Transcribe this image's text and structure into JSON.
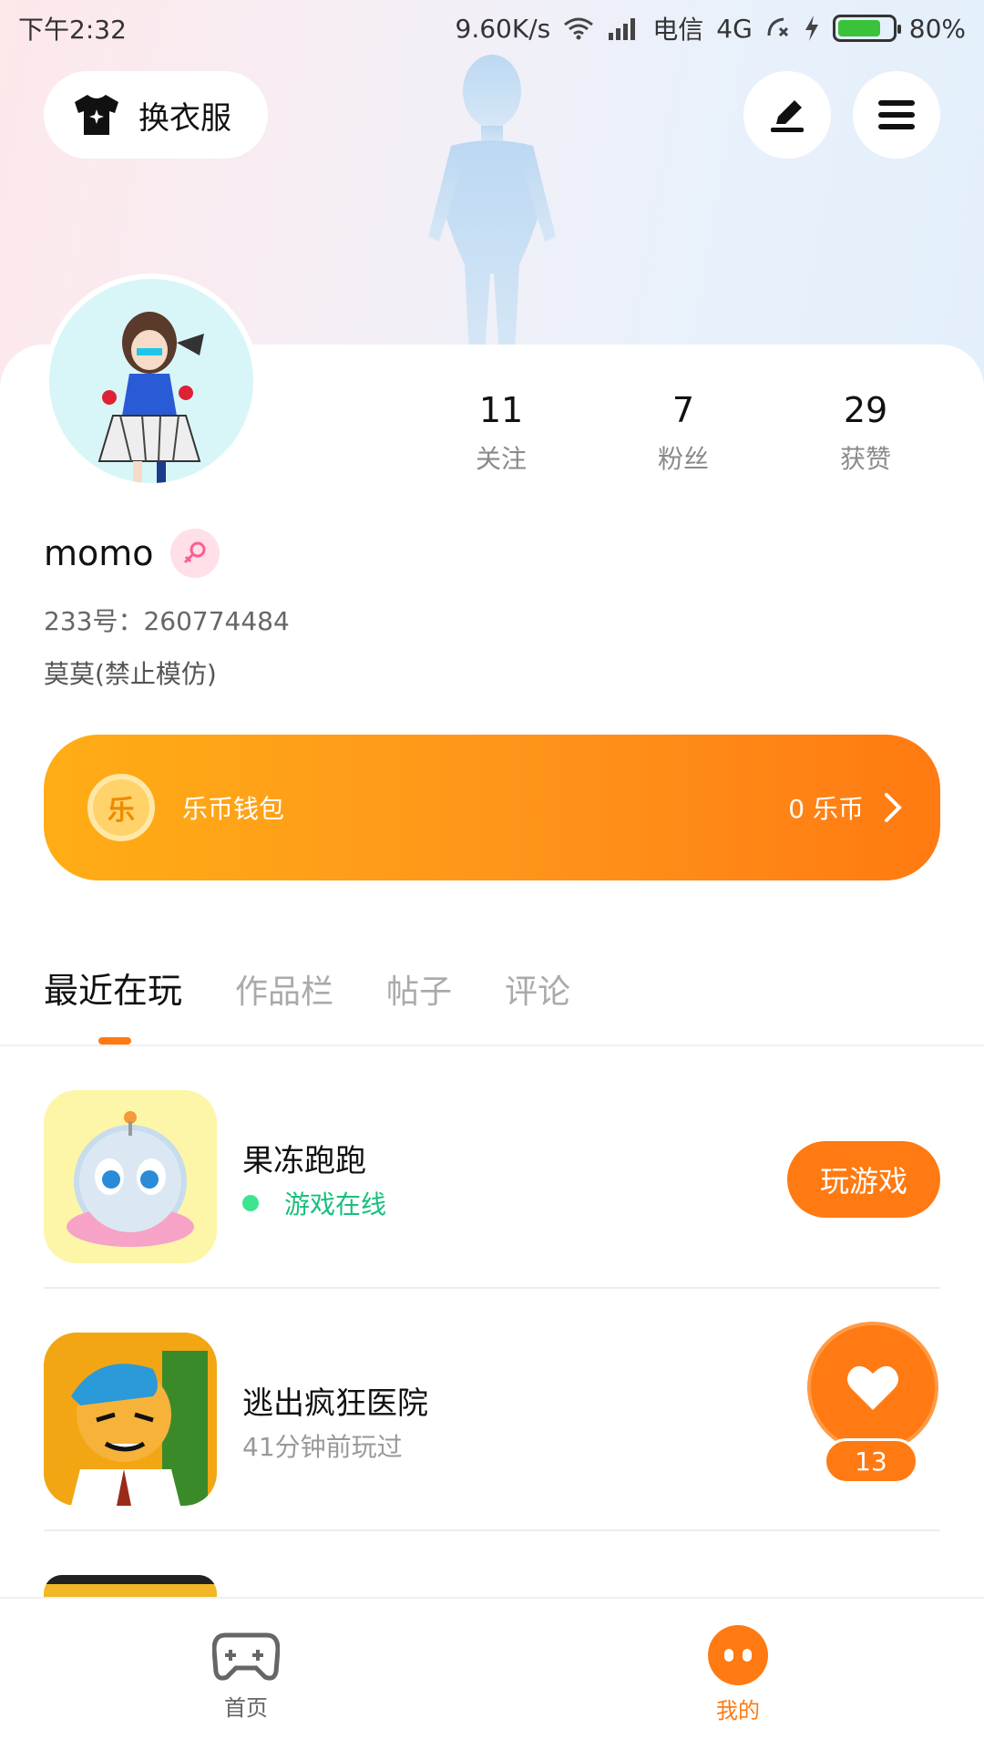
{
  "status_bar": {
    "time": "下午2:32",
    "network_speed": "9.60K/s",
    "carrier": "电信",
    "network_type": "4G",
    "battery": "80%",
    "battery_level": 0.8
  },
  "header": {
    "outfit_label": "换衣服"
  },
  "profile": {
    "stats": [
      {
        "value": "11",
        "label": "关注"
      },
      {
        "value": "7",
        "label": "粉丝"
      },
      {
        "value": "29",
        "label": "获赞"
      }
    ],
    "name": "momo",
    "uid": "233号：260774484",
    "bio": "莫莫(禁止模仿)"
  },
  "wallet": {
    "coin_glyph": "乐",
    "title": "乐币钱包",
    "amount": "0 乐币"
  },
  "tabs": [
    {
      "label": "最近在玩",
      "active": true
    },
    {
      "label": "作品栏",
      "active": false
    },
    {
      "label": "帖子",
      "active": false
    },
    {
      "label": "评论",
      "active": false
    }
  ],
  "games": [
    {
      "title": "果冻跑跑",
      "status": "游戏在线",
      "action": "玩游戏"
    },
    {
      "title": "逃出疯狂医院",
      "subtitle": "41分钟前玩过"
    }
  ],
  "like_float": {
    "count": "13"
  },
  "bottom_nav": [
    {
      "label": "首页",
      "icon": "gamepad-icon"
    },
    {
      "label": "我的",
      "icon": "me-face-icon",
      "active": true
    }
  ],
  "colors": {
    "accent": "#ff7a12",
    "online": "#17c07c",
    "wallet_gradient_start": "#ffad15",
    "wallet_gradient_end": "#ff7a12"
  }
}
